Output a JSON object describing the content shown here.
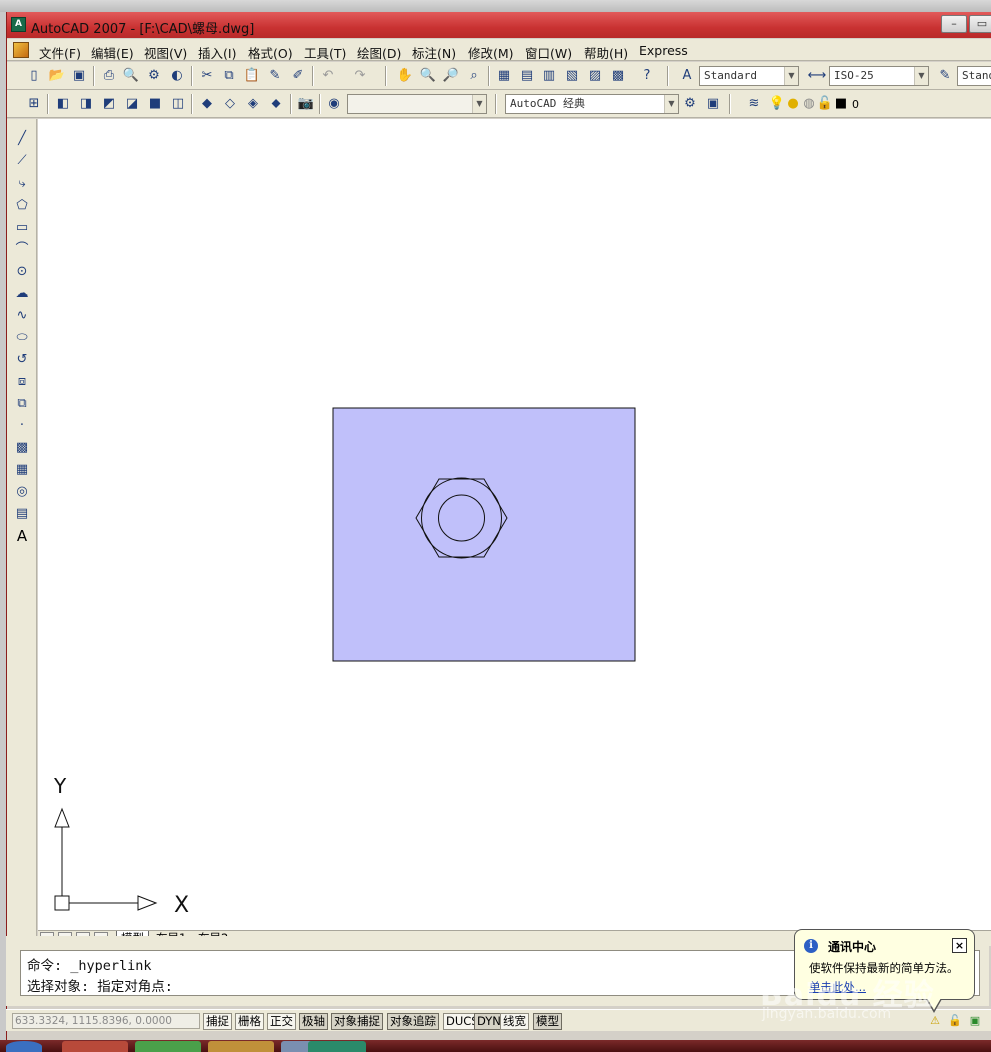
{
  "window": {
    "title": "AutoCAD 2007 - [F:\\CAD\\螺母.dwg]",
    "app_icon": "autocad-icon",
    "controls": [
      "minimize-icon",
      "restore-icon"
    ]
  },
  "menubar": {
    "items": [
      "文件(F)",
      "编辑(E)",
      "视图(V)",
      "插入(I)",
      "格式(O)",
      "工具(T)",
      "绘图(D)",
      "标注(N)",
      "修改(M)",
      "窗口(W)",
      "帮助(H)",
      "Express"
    ]
  },
  "toolbar": {
    "text_style": "Standard",
    "dim_style": "ISO-25",
    "table_style": "Stand",
    "view_combo": "",
    "workspace": "AutoCAD 经典",
    "layer_name": "0"
  },
  "drawing": {
    "fill_color": "#c0c0fa",
    "line_color": "#111111",
    "ucs": {
      "x_label": "X",
      "y_label": "Y"
    }
  },
  "layout_tabs": {
    "items": [
      "模型",
      "布局1",
      "布局2"
    ],
    "active": "模型"
  },
  "command": {
    "line1": "命令: _hyperlink",
    "line2": "选择对象: 指定对角点:"
  },
  "statusbar": {
    "coords": "633.3324,   1115.8396,  0.0000",
    "buttons": [
      "捕捉",
      "栅格",
      "正交",
      "极轴",
      "对象捕捉",
      "对象追踪",
      "DUCS",
      "DYN",
      "线宽",
      "模型"
    ]
  },
  "balloon": {
    "title": "通讯中心",
    "text": "使软件保持最新的简单方法。",
    "link": "单击此处..."
  },
  "watermark": {
    "brand": "Baidu 经验",
    "url": "jingyan.baidu.com"
  }
}
